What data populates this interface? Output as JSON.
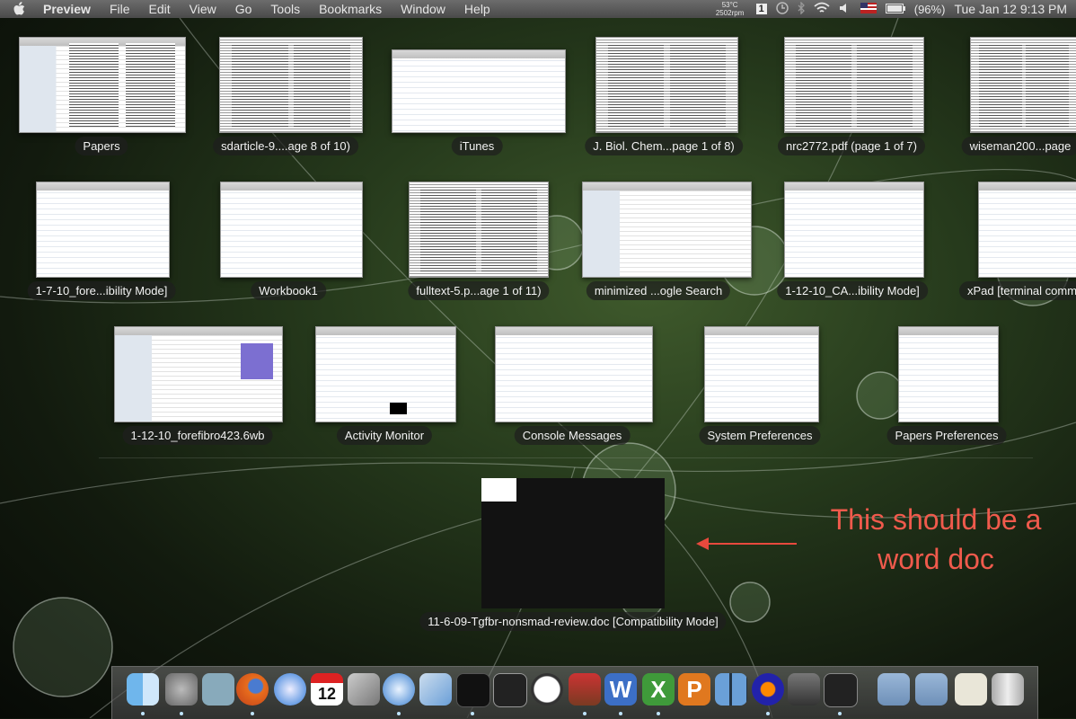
{
  "menubar": {
    "app_name": "Preview",
    "items": [
      "File",
      "Edit",
      "View",
      "Go",
      "Tools",
      "Bookmarks",
      "Window",
      "Help"
    ],
    "temp": "53°C",
    "fan": "2502rpm",
    "battery": "(96%)",
    "clock": "Tue Jan 12  9:13 PM",
    "badge": "1"
  },
  "windows": {
    "row1": [
      "Papers",
      "sdarticle-9....age 8 of 10)",
      "iTunes",
      "J. Biol. Chem...page 1 of 8)",
      "nrc2772.pdf (page 1 of 7)",
      "wiseman200...page"
    ],
    "row2": [
      "1-7-10_fore...ibility Mode]",
      "Workbook1",
      "fulltext-5.p...age 1 of 11)",
      "minimized ...ogle Search",
      "1-12-10_CA...ibility Mode]",
      "xPad [terminal comm"
    ],
    "row3": [
      "1-12-10_forefibro423.6wb",
      "Activity Monitor",
      "Console Messages",
      "System Preferences",
      "Papers Preferences"
    ],
    "bottom": "11-6-09-Tgfbr-nonsmad-review.doc [Compatibility Mode]"
  },
  "annotation": {
    "line1": "This should be a",
    "line2": "word doc",
    "color": "#f05a4c"
  },
  "dock": {
    "icons": [
      "finder-icon",
      "system-preferences-icon",
      "mail-icon",
      "firefox-icon",
      "safari-icon",
      "ical-icon",
      "iphoto-icon",
      "itunes-icon",
      "xcode-icon",
      "activity-monitor-icon",
      "terminal-icon",
      "clock-icon",
      "bookends-icon",
      "word-icon",
      "excel-icon",
      "powerpoint-icon",
      "spaces-icon",
      "audacity-icon",
      "microphone-icon",
      "console-icon",
      "folder-icon",
      "downloads-folder-icon",
      "documents-icon",
      "trash-icon"
    ]
  }
}
